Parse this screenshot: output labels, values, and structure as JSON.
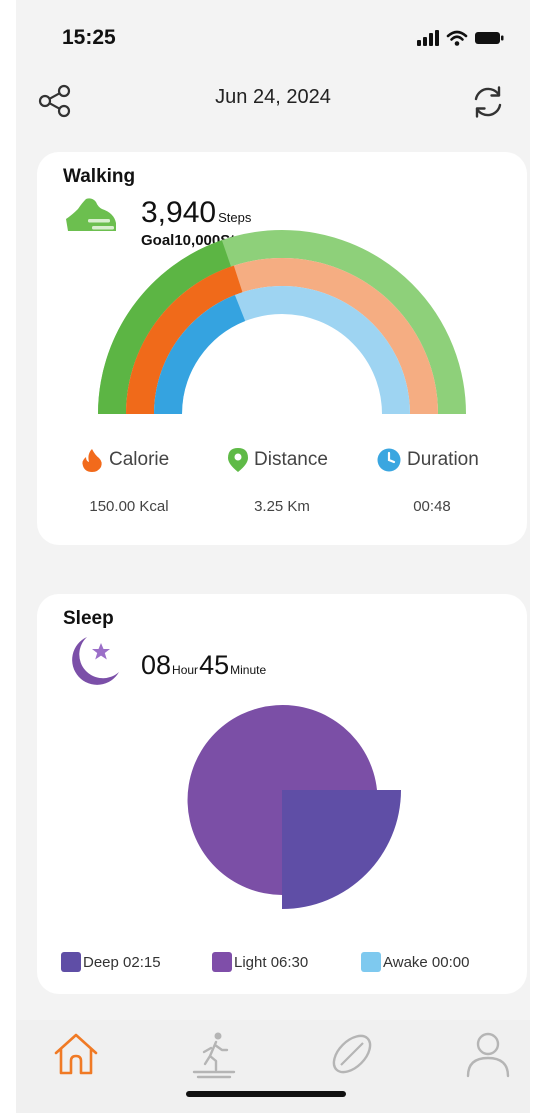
{
  "status": {
    "time": "15:25"
  },
  "header": {
    "date": "Jun 24, 2024"
  },
  "walking": {
    "title": "Walking",
    "steps": "3,940",
    "steps_unit": "Steps",
    "goal": "Goal10,000Steps",
    "progress": {
      "steps": 0.394,
      "calorie": 0.4,
      "duration": 0.38
    },
    "stats": [
      {
        "label": "Calorie",
        "value": "150.00 Kcal",
        "color": "#f26a1b"
      },
      {
        "label": "Distance",
        "value": "3.25 Km",
        "color": "#5fba47"
      },
      {
        "label": "Duration",
        "value": "00:48",
        "color": "#3aa6e0"
      }
    ],
    "colors": {
      "outer": "#5cb544",
      "outer_light": "#8ed07a",
      "mid": "#f06a1a",
      "mid_light": "#f5ad82",
      "inner": "#35a3e0",
      "inner_light": "#9ed4f2"
    }
  },
  "sleep": {
    "title": "Sleep",
    "hours": "08",
    "hour_unit": "Hour",
    "minutes": "45",
    "minute_unit": "Minute",
    "legend": [
      {
        "label": "Deep 02:15",
        "color": "#5f4ea6"
      },
      {
        "label": "Light 06:30",
        "color": "#7f4ea9"
      },
      {
        "label": "Awake 00:00",
        "color": "#7ec9ef"
      }
    ]
  },
  "tabs": [
    "home-icon",
    "walking-icon",
    "sport-icon",
    "profile-icon"
  ],
  "accent": "#f07a25"
}
